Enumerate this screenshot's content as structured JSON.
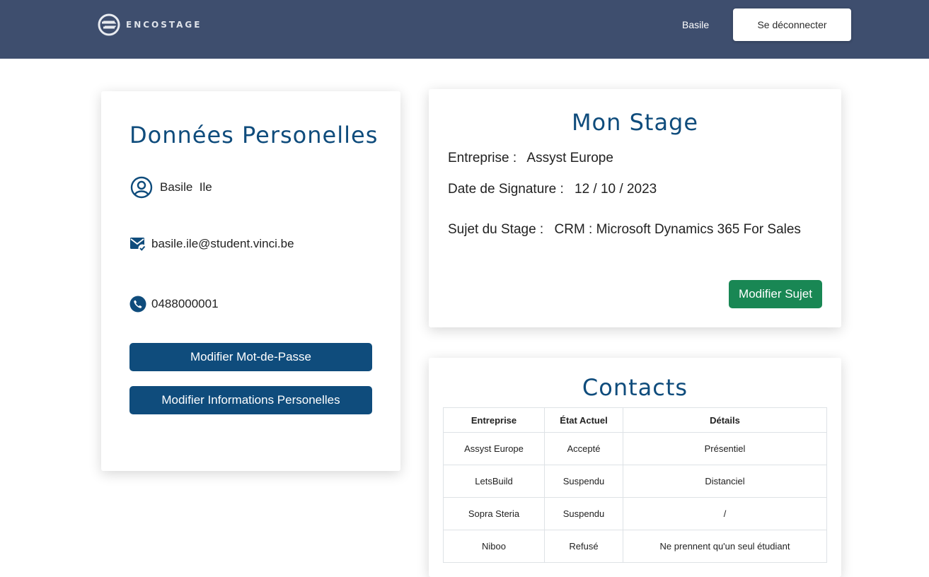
{
  "header": {
    "logo_text": "ENCOSTAGE",
    "user_name": "Basile",
    "logout_label": "Se déconnecter"
  },
  "personal": {
    "title": "Données Personelles",
    "full_name": "Basile  Ile",
    "email": "basile.ile@student.vinci.be",
    "phone": "0488000001",
    "change_password_label": "Modifier Mot-de-Passe",
    "edit_info_label": "Modifier Informations Personelles"
  },
  "stage": {
    "title": "Mon Stage",
    "company_label": "Entreprise :",
    "company": "Assyst Europe",
    "signature_label": "Date de Signature :",
    "signature_date": "12 / 10 / 2023",
    "subject_label": "Sujet du Stage :",
    "subject": "CRM : Microsoft Dynamics 365 For Sales",
    "edit_subject_label": "Modifier Sujet"
  },
  "contacts": {
    "title": "Contacts",
    "columns": [
      "Entreprise",
      "État Actuel",
      "Détails"
    ],
    "rows": [
      [
        "Assyst Europe",
        "Accepté",
        "Présentiel"
      ],
      [
        "LetsBuild",
        "Suspendu",
        "Distanciel"
      ],
      [
        "Sopra Steria",
        "Suspendu",
        "/"
      ],
      [
        "Niboo",
        "Refusé",
        "Ne prennent qu'un seul étudiant"
      ]
    ]
  },
  "colors": {
    "navbar": "#3e4e6e",
    "primary_blue": "#0f4c7c",
    "success_green": "#198754"
  },
  "icons": [
    "logo-icon",
    "user-circle-icon",
    "mail-check-icon",
    "phone-icon"
  ]
}
